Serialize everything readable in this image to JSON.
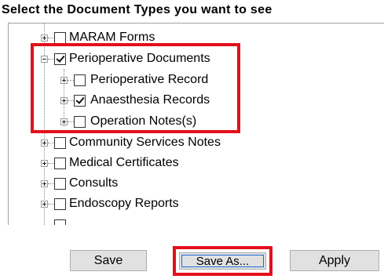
{
  "heading": "Select the Document Types you want to see",
  "tree": {
    "items": [
      {
        "label": "MARAM Forms",
        "checked": false,
        "expanded": false
      },
      {
        "label": "Perioperative Documents",
        "checked": true,
        "expanded": true
      },
      {
        "label": "Perioperative Record",
        "checked": false,
        "expanded": false
      },
      {
        "label": "Anaesthesia Records",
        "checked": true,
        "expanded": false
      },
      {
        "label": "Operation Notes(s)",
        "checked": false,
        "expanded": false
      },
      {
        "label": "Community Services Notes",
        "checked": false,
        "expanded": false
      },
      {
        "label": "Medical Certificates",
        "checked": false,
        "expanded": false
      },
      {
        "label": "Consults",
        "checked": false,
        "expanded": false
      },
      {
        "label": "Endoscopy Reports",
        "checked": false,
        "expanded": false
      }
    ]
  },
  "buttons": {
    "save": "Save",
    "save_as": "Save As...",
    "apply": "Apply"
  },
  "colors": {
    "highlight": "#e3101b",
    "button_bg": "#e1e1e1",
    "focus_border": "#1b6bd1"
  }
}
